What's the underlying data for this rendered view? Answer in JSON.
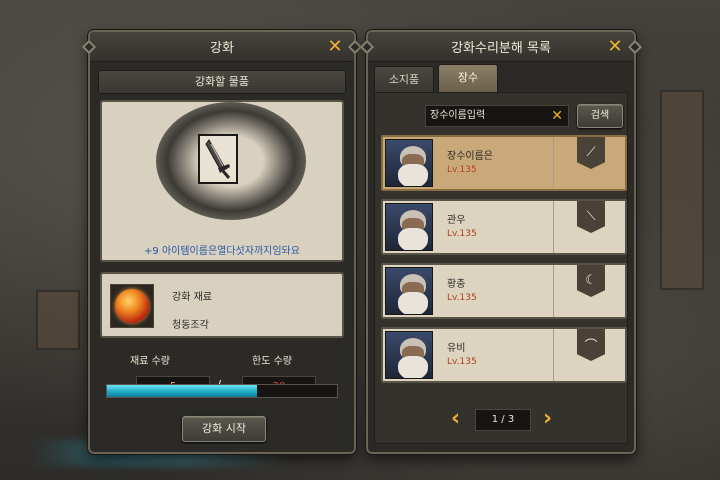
{
  "enhance_panel": {
    "title": "강화",
    "section_title": "강화할 물품",
    "item_name": "+9 아이템이름은열다섯자까지임돠요",
    "material_label": "강화 재료",
    "material_name": "청동조각",
    "material_count_label": "재료 수량",
    "limit_count_label": "한도 수량",
    "material_count": "5",
    "limit_count": "20",
    "slash": "/",
    "progress_percent": 65,
    "start_button": "강화 시작"
  },
  "list_panel": {
    "title": "강화수리분해 목록",
    "tabs": [
      {
        "label": "소지품",
        "active": false
      },
      {
        "label": "장수",
        "active": true
      }
    ],
    "search": {
      "value": "장수이름입력",
      "button": "검색"
    },
    "generals": [
      {
        "name": "장수이름은",
        "level": "Lv.135",
        "selected": true,
        "weapon_icon": "spear-icon"
      },
      {
        "name": "관우",
        "level": "Lv.135",
        "selected": false,
        "weapon_icon": "glaive-icon"
      },
      {
        "name": "황충",
        "level": "Lv.135",
        "selected": false,
        "weapon_icon": "blade-icon"
      },
      {
        "name": "유비",
        "level": "Lv.135",
        "selected": false,
        "weapon_icon": "bow-icon"
      }
    ],
    "pager": {
      "text": "1 / 3"
    }
  },
  "colors": {
    "accent_gold": "#f2b230",
    "progress_cyan": "#1ca6c4",
    "level_red": "#b0401c",
    "item_name_blue": "#2a56a8"
  }
}
